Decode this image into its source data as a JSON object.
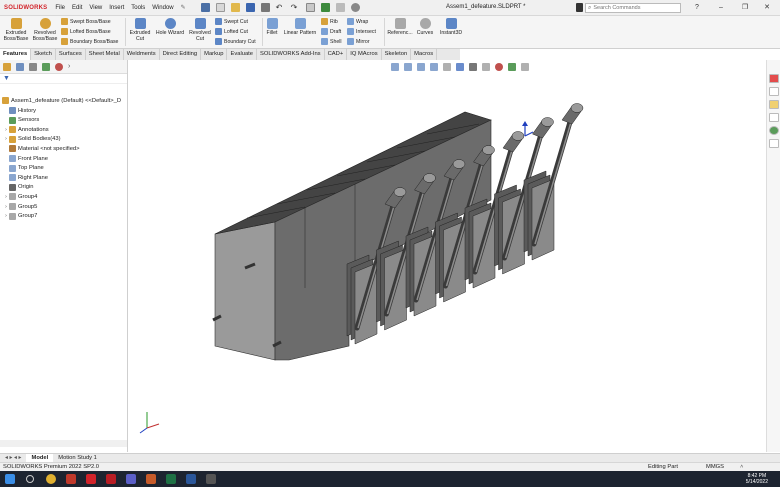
{
  "app": {
    "logo": "SOLIDWORKS",
    "menu": [
      "File",
      "Edit",
      "View",
      "Insert",
      "Tools",
      "Window"
    ],
    "document_title": "Assem1_defeature.SLDPRT *",
    "search_placeholder": "Search Commands"
  },
  "ribbon": {
    "extruded_boss": "Extruded\nBoss/Base",
    "revolved_boss": "Revolved\nBoss/Base",
    "swept_boss": "Swept Boss/Base",
    "lofted_boss": "Lofted Boss/Base",
    "boundary_boss": "Boundary Boss/Base",
    "extruded_cut": "Extruded\nCut",
    "hole_wizard": "Hole Wizard",
    "revolved_cut": "Revolved\nCut",
    "swept_cut": "Swept Cut",
    "lofted_cut": "Lofted Cut",
    "boundary_cut": "Boundary Cut",
    "fillet": "Fillet",
    "linear_pattern": "Linear Pattern",
    "rib": "Rib",
    "draft": "Draft",
    "shell": "Shell",
    "wrap": "Wrap",
    "intersect": "Intersect",
    "mirror": "Mirror",
    "reference": "Referenc...",
    "curves": "Curves",
    "instant3d": "Instant3D"
  },
  "tabs": [
    "Features",
    "Sketch",
    "Surfaces",
    "Sheet Metal",
    "Weldments",
    "Direct Editing",
    "Markup",
    "Evaluate",
    "SOLIDWORKS Add-Ins",
    "CAD+",
    "IQ MAcros",
    "Skeleton",
    "Macros"
  ],
  "tree": {
    "root": "Assem1_defeature (Default) <<Default>_D",
    "items": [
      {
        "label": "History",
        "twist": ""
      },
      {
        "label": "Sensors",
        "twist": ""
      },
      {
        "label": "Annotations",
        "twist": "›"
      },
      {
        "label": "Solid Bodies(43)",
        "twist": "›"
      },
      {
        "label": "Material <not specified>",
        "twist": ""
      },
      {
        "label": "Front Plane",
        "twist": ""
      },
      {
        "label": "Top Plane",
        "twist": ""
      },
      {
        "label": "Right Plane",
        "twist": ""
      },
      {
        "label": "Origin",
        "twist": ""
      },
      {
        "label": "Group4",
        "twist": "›"
      },
      {
        "label": "Group5",
        "twist": "›"
      },
      {
        "label": "Group7",
        "twist": "›"
      }
    ]
  },
  "bottom_tabs": [
    "Model",
    "Motion Study 1"
  ],
  "status": {
    "product": "SOLIDWORKS Premium 2022 SP2.0",
    "mode": "Editing Part",
    "units": "MMGS"
  },
  "clock": {
    "time": "8:42 PM",
    "date": "5/14/2022"
  },
  "colors": {
    "accent": "#d2232a",
    "model_top": "#444444",
    "model_front": "#9a9a9a",
    "model_side": "#6c6c6c"
  }
}
